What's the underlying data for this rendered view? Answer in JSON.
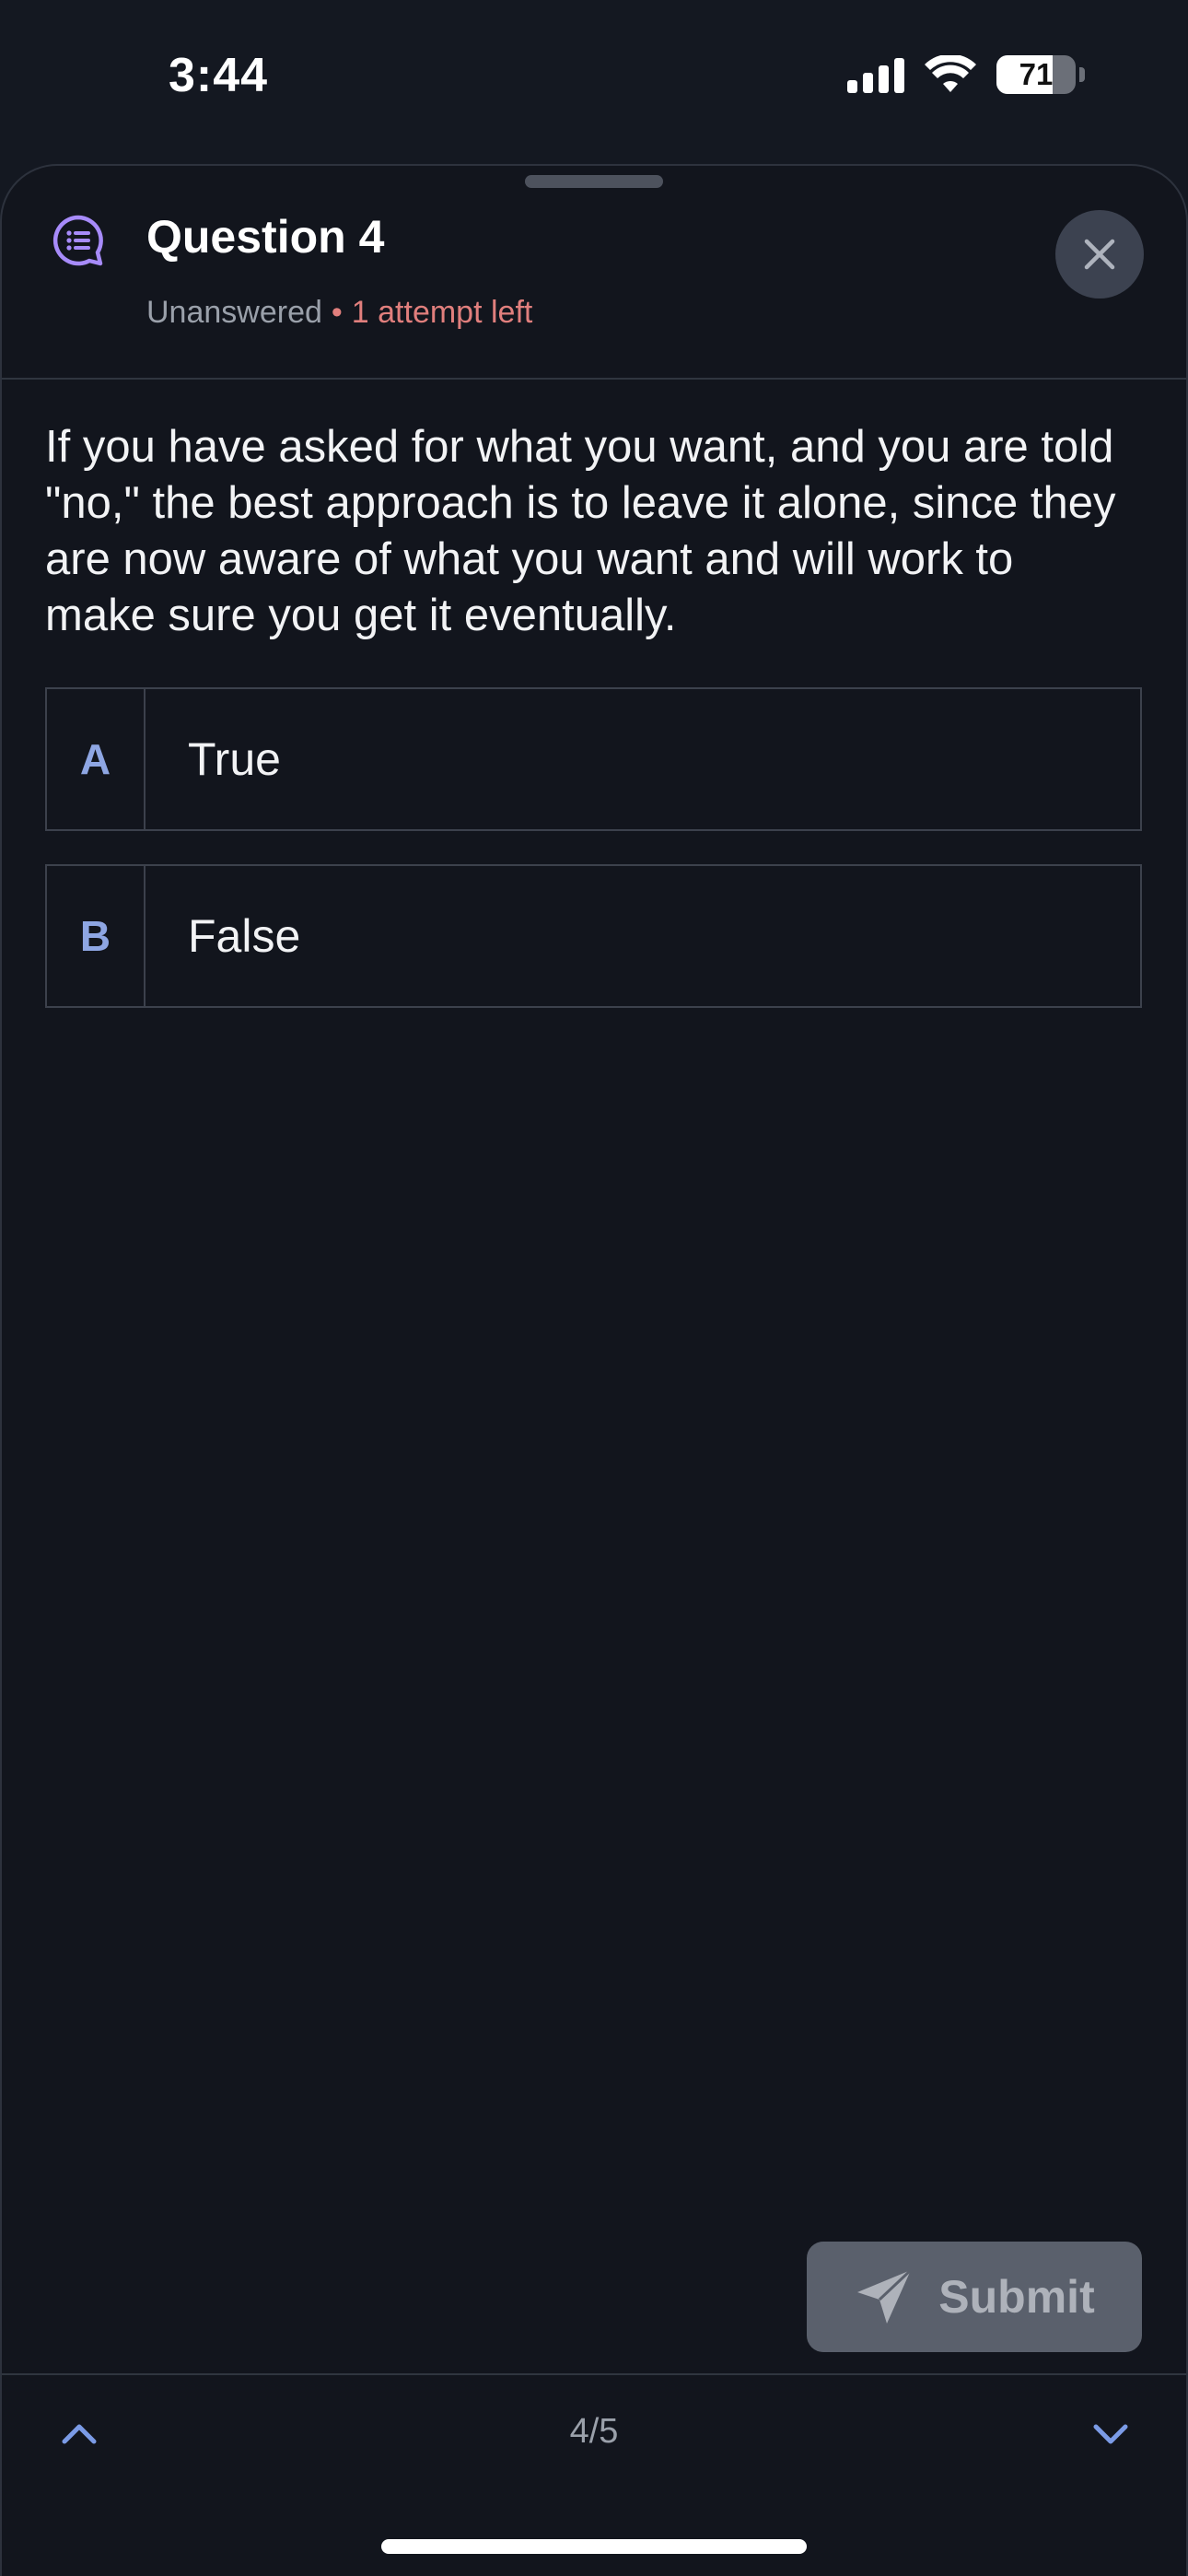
{
  "status_bar": {
    "time": "3:44",
    "battery_percent": "71",
    "battery_level": 0.71
  },
  "question": {
    "icon": "quiz-chat-icon",
    "title": "Question 4",
    "status": "Unanswered",
    "separator": "•",
    "attempts": "1 attempt left",
    "text": "If you have asked for what you want, and you are told \"no,\" the best approach is to leave it alone, since they are now aware of what you want and will work to make sure you get it eventually."
  },
  "options": [
    {
      "letter": "A",
      "label": "True"
    },
    {
      "letter": "B",
      "label": "False"
    }
  ],
  "actions": {
    "submit_label": "Submit",
    "submit_icon": "paper-plane-icon",
    "close_icon": "close-icon"
  },
  "pagination": {
    "indicator": "4/5",
    "prev_icon": "chevron-up-icon",
    "next_icon": "chevron-down-icon"
  },
  "colors": {
    "background": "#12151d",
    "accent_blue": "#8ea6e3",
    "warning_red": "#e17f7d",
    "icon_purple": "#a78bfa"
  }
}
